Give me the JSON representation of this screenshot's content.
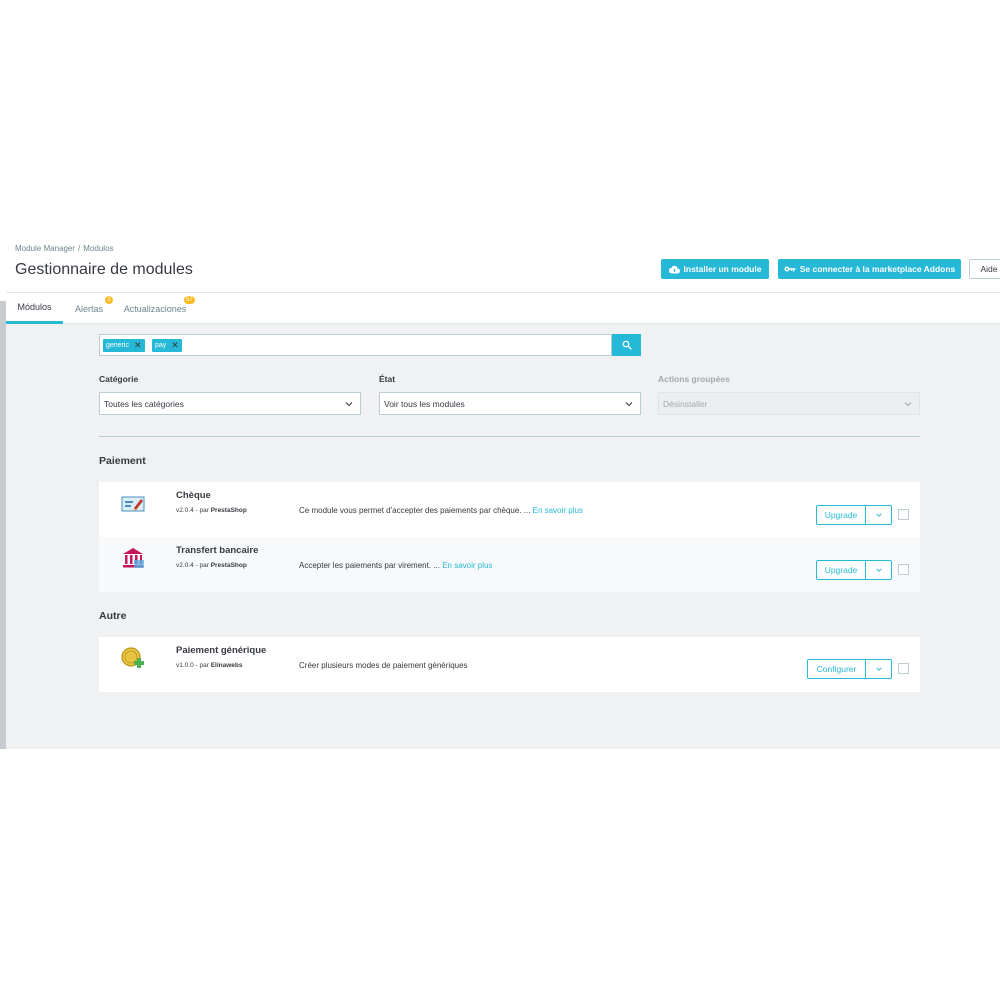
{
  "breadcrumb": [
    "Module Manager",
    "/",
    "Modulos"
  ],
  "page_title": "Gestionnaire de modules",
  "toolbar": {
    "install_label": "Installer un module",
    "marketplace_label": "Se connecter à la marketplace Addons",
    "help_label": "Aide"
  },
  "tabs": [
    {
      "label": "Módulos",
      "active": true,
      "badge": ""
    },
    {
      "label": "Alertas",
      "active": false,
      "badge": "2"
    },
    {
      "label": "Actualizaciones",
      "active": false,
      "badge": "57"
    }
  ],
  "search": {
    "chips": [
      "generic",
      "pay"
    ]
  },
  "filters": {
    "category": {
      "label": "Catégorie",
      "value": "Toutes les catégories"
    },
    "state": {
      "label": "État",
      "value": "Voir tous les modules"
    },
    "bulk": {
      "label": "Actions groupées",
      "value": "Désinstaller"
    }
  },
  "sections": [
    {
      "title": "Paiement",
      "modules": [
        {
          "name": "Chèque",
          "version": "v2.0.4",
          "by": " - par ",
          "author": "PrestaShop",
          "description": "Ce module vous permet d'accepter des paiements par chèque. ...",
          "more": "En savoir plus",
          "action": "Upgrade",
          "icon": "cheque-icon"
        },
        {
          "name": "Transfert bancaire",
          "version": "v2.0.4",
          "by": " - par ",
          "author": "PrestaShop",
          "description": "Accepter les paiements par virement. ...",
          "more": "En savoir plus",
          "action": "Upgrade",
          "icon": "bank-icon"
        }
      ]
    },
    {
      "title": "Autre",
      "modules": [
        {
          "name": "Paiement générique",
          "version": "v1.0.0",
          "by": " - par ",
          "author": "Elinawebs",
          "description": "Créer plusieurs modes de paiement génériques",
          "more": "",
          "action": "Configurer",
          "icon": "coin-add-icon"
        }
      ]
    }
  ],
  "colors": {
    "accent": "#25b9d7",
    "badge": "#fbbb22",
    "background": "#eff1f2"
  }
}
